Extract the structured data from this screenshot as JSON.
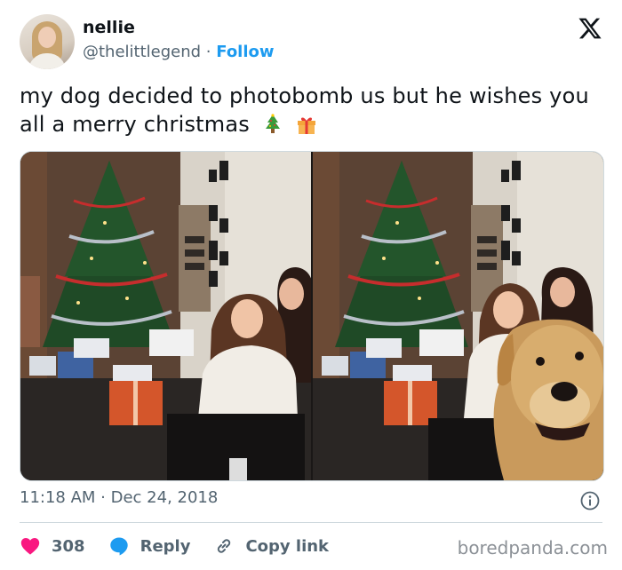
{
  "author": {
    "name": "nellie",
    "handle": "@thelittlegend",
    "separator": " · ",
    "follow_label": "Follow"
  },
  "tweet": {
    "text": "my dog decided to photobomb us but he wishes you all a merry christmas",
    "emojis": [
      "christmas-tree-icon",
      "gift-icon"
    ]
  },
  "media": {
    "panels": [
      "photo-left",
      "photo-right-with-dog"
    ]
  },
  "meta": {
    "time": "11:18 AM",
    "separator": " · ",
    "date": "Dec 24, 2018"
  },
  "actions": {
    "like_count": "308",
    "reply_label": "Reply",
    "copy_link_label": "Copy link"
  },
  "watermark": "boredpanda.com",
  "colors": {
    "accent": "#1d9bf0",
    "like": "#f91880",
    "reply": "#1d9bf0",
    "secondary_text": "#536471",
    "primary_text": "#0f1419"
  }
}
